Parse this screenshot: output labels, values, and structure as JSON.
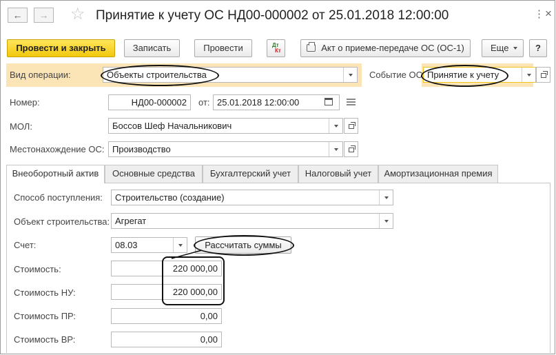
{
  "window": {
    "title": "Принятие к учету ОС НД00-000002 от 25.01.2018 12:00:00",
    "nav_back": "←",
    "nav_forward": "→",
    "favorite": "☆",
    "menu": "⋮",
    "close": "×"
  },
  "toolbar": {
    "post_and_close": "Провести и закрыть",
    "save": "Записать",
    "post": "Провести",
    "dt_label": "Дт",
    "kt_label": "Кт",
    "act_print": "Акт о приеме-передаче ОС (ОС-1)",
    "more": "Еще"
  },
  "header": {
    "operation_label": "Вид операции:",
    "operation_value": "Объекты строительства",
    "event_label": "Событие ОС:",
    "event_value": "Принятие к учету",
    "number_label": "Номер:",
    "number_value": "НД00-000002",
    "date_label": "от:",
    "date_value": "25.01.2018 12:00:00",
    "mol_label": "МОЛ:",
    "mol_value": "Боссов Шеф Начальникович",
    "location_label": "Местонахождение ОС:",
    "location_value": "Производство"
  },
  "tabs": [
    {
      "label": "Внеоборотный актив",
      "active": true
    },
    {
      "label": "Основные средства",
      "active": false
    },
    {
      "label": "Бухгалтерский учет",
      "active": false
    },
    {
      "label": "Налоговый учет",
      "active": false
    },
    {
      "label": "Амортизационная премия",
      "active": false
    }
  ],
  "asset": {
    "receipt_method_label": "Способ поступления:",
    "receipt_method_value": "Строительство (создание)",
    "construction_object_label": "Объект строительства:",
    "construction_object_value": "Агрегат",
    "account_label": "Счет:",
    "account_value": "08.03",
    "calculate_button": "Рассчитать суммы",
    "cost_label": "Стоимость:",
    "cost_value": "220 000,00",
    "cost_nu_label": "Стоимость НУ:",
    "cost_nu_value": "220 000,00",
    "cost_pr_label": "Стоимость ПР:",
    "cost_pr_value": "0,00",
    "cost_vr_label": "Стоимость ВР:",
    "cost_vr_value": "0,00"
  },
  "colors": {
    "primary_button": "#f2c80d",
    "highlight": "#fbe5b7",
    "event_border": "#f0c419"
  }
}
